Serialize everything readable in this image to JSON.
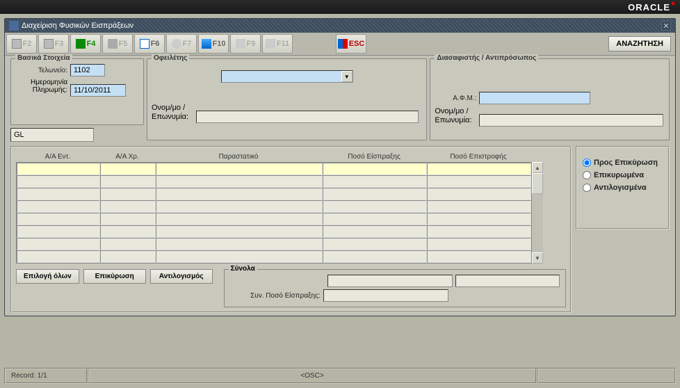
{
  "oracle": "ORACLE",
  "window_title": "Διαχείριση Φυσικών Εισπράξεων",
  "toolbar": {
    "f2": "F2",
    "f3": "F3",
    "f4": "F4",
    "f5": "F5",
    "f6": "F6",
    "f7": "F7",
    "f10": "F10",
    "f9": "F9",
    "f11": "F11",
    "esc": "ESC",
    "search": "ΑΝΑΖΗΤΗΣΗ"
  },
  "basic": {
    "legend": "Βασικά Στοιχεία",
    "customs_label": "Τελωνείο:",
    "customs_value": "1102",
    "paydate_label1": "Ημερομηνία",
    "paydate_label2": "Πληρωμής:",
    "paydate_value": "11/10/2011",
    "gl_value": "GL"
  },
  "debtor": {
    "legend": "Οφειλέτης",
    "name_label1": "Ονομ/μο /",
    "name_label2": "Επωνυμία:",
    "name_value": ""
  },
  "insurer": {
    "legend": "Διασαφιστής / Αντιπρόσωπος",
    "afm_label": "Α.Φ.Μ.:",
    "afm_value": "",
    "name_label1": "Ονομ/μο /",
    "name_label2": "Επωνυμία:",
    "name_value": ""
  },
  "grid": {
    "col_aa_ent": "Α/Α Εντ.",
    "col_aa_chr": "Α/Α Χρ.",
    "col_doc": "Παραστατικό",
    "col_amt_in": "Ποσό Είσπραξης",
    "col_amt_ret": "Ποσό Επιστροφής"
  },
  "filters": {
    "pending": "Προς Επικύρωση",
    "confirmed": "Επικυρωμένα",
    "reversed": "Αντιλογισμένα"
  },
  "actions": {
    "select_all": "Επιλογή όλων",
    "confirm": "Επικύρωση",
    "reverse": "Αντιλογισμός"
  },
  "totals": {
    "legend": "Σύνολα",
    "sum_label": "Συν. Ποσό Είσπραξης:",
    "sum_value": "",
    "top_value": ""
  },
  "status": {
    "record": "Record: 1/1",
    "osc": "<OSC>"
  }
}
